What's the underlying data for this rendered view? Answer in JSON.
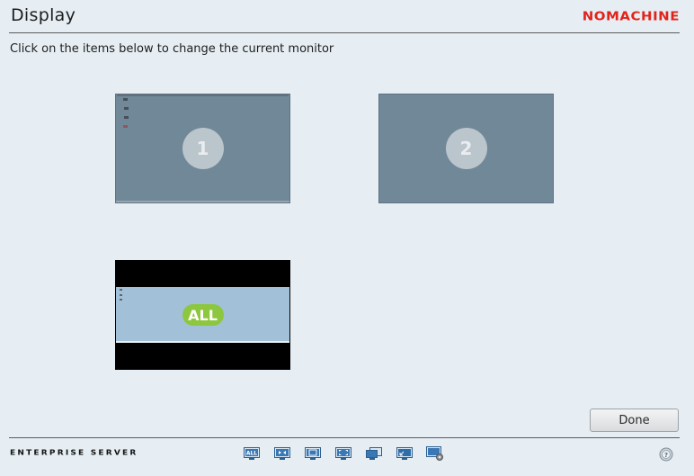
{
  "header": {
    "title": "Display",
    "brand": "NOMACHINE"
  },
  "instruction": "Click on the items below to change the current monitor",
  "monitors": [
    {
      "label": "1"
    },
    {
      "label": "2"
    },
    {
      "label": "ALL"
    }
  ],
  "done_label": "Done",
  "footer": {
    "edition": "ENTERPRISE SERVER",
    "toolbar_icons": [
      "all-monitors-icon",
      "fit-screen-icon",
      "window-mode-icon",
      "fullscreen-icon",
      "resize-remote-icon",
      "viewport-icon",
      "display-settings-icon"
    ],
    "help_icon": "help-icon"
  },
  "colors": {
    "brand": "#e2231a",
    "background": "#e6eef4",
    "monitor": "#718898",
    "all_badge": "#8dc63f"
  }
}
